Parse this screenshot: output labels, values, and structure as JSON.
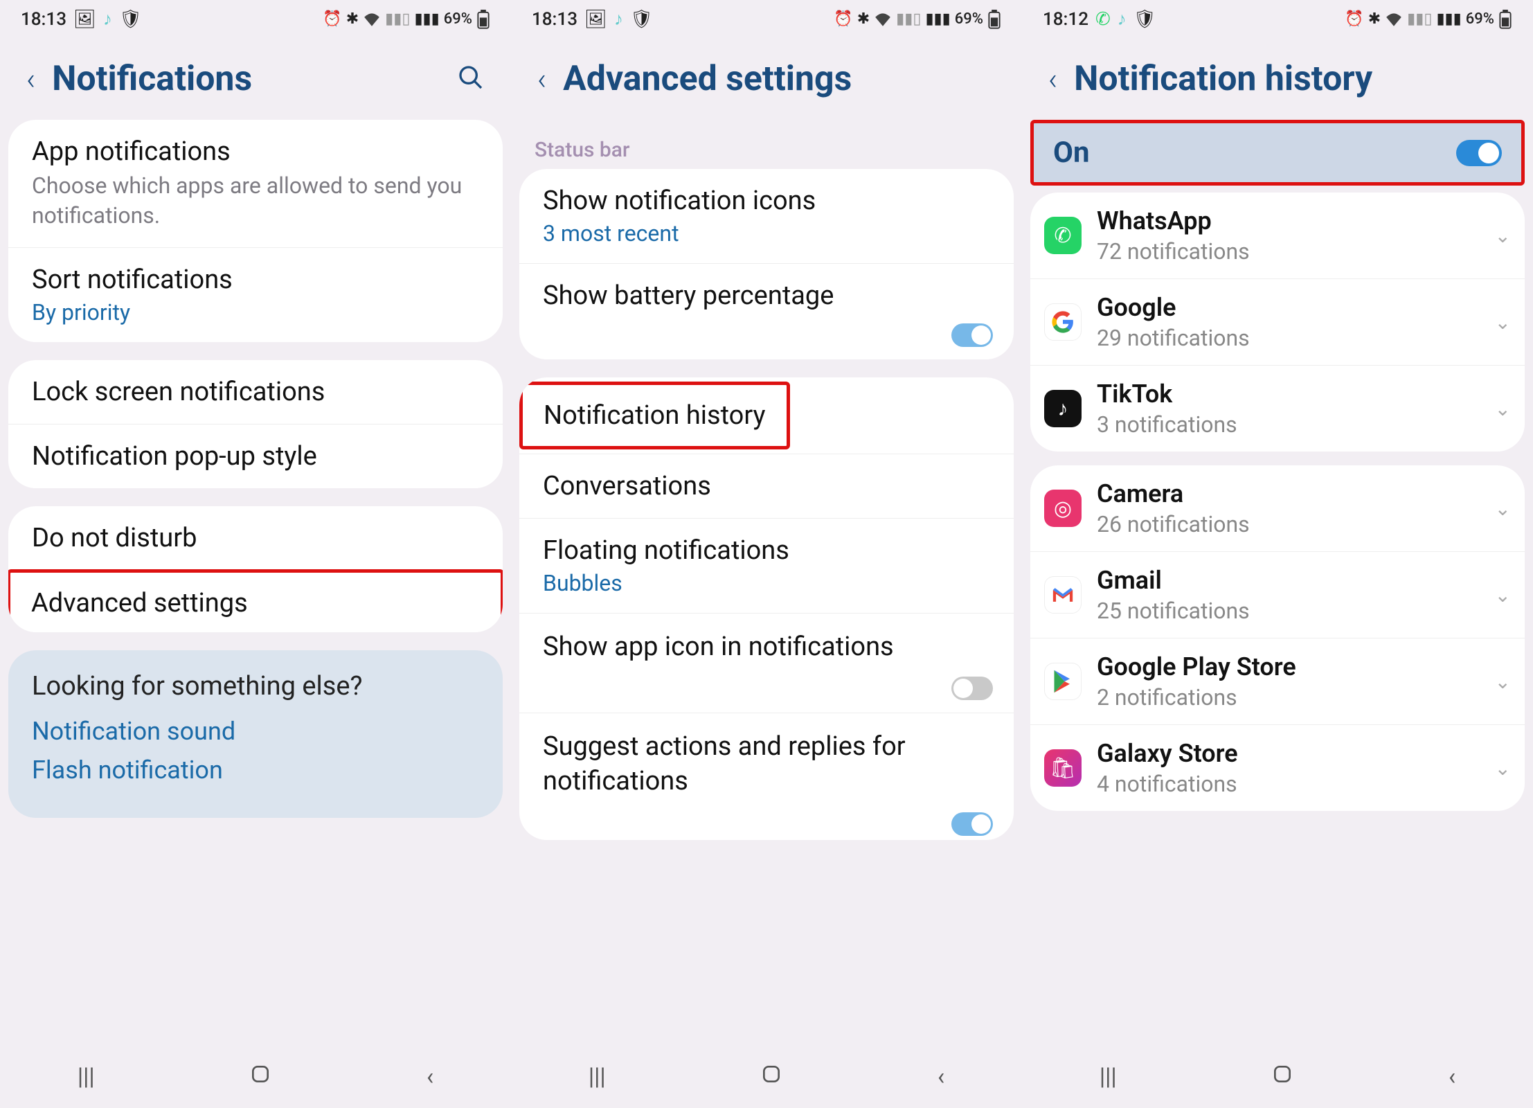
{
  "phone1": {
    "status": {
      "time": "18:13",
      "battery": "69%"
    },
    "title": "Notifications",
    "appNotif": {
      "title": "App notifications",
      "desc": "Choose which apps are allowed to send you notifications."
    },
    "sort": {
      "title": "Sort notifications",
      "sub": "By priority"
    },
    "lock": "Lock screen notifications",
    "popup": "Notification pop-up style",
    "dnd": "Do not disturb",
    "advanced": "Advanced settings",
    "footer": {
      "title": "Looking for something else?",
      "link1": "Notification sound",
      "link2": "Flash notification"
    }
  },
  "phone2": {
    "status": {
      "time": "18:13",
      "battery": "69%"
    },
    "title": "Advanced settings",
    "sectionLabel": "Status bar",
    "showIcons": {
      "title": "Show notification icons",
      "sub": "3 most recent"
    },
    "showBattery": "Show battery percentage",
    "history": "Notification history",
    "conversations": "Conversations",
    "floating": {
      "title": "Floating notifications",
      "sub": "Bubbles"
    },
    "showAppIcon": "Show app icon in notifications",
    "suggest": "Suggest actions and replies for notifications"
  },
  "phone3": {
    "status": {
      "time": "18:12",
      "battery": "69%"
    },
    "title": "Notification history",
    "onLabel": "On",
    "apps": [
      {
        "name": "WhatsApp",
        "count": "72 notifications",
        "icon": "whatsapp",
        "bg": "#25d366"
      },
      {
        "name": "Google",
        "count": "29 notifications",
        "icon": "google",
        "bg": "#fff"
      },
      {
        "name": "TikTok",
        "count": "3 notifications",
        "icon": "tiktok",
        "bg": "#111"
      },
      {
        "name": "Camera",
        "count": "26 notifications",
        "icon": "camera",
        "bg": "#e8356e"
      },
      {
        "name": "Gmail",
        "count": "25 notifications",
        "icon": "gmail",
        "bg": "#fff"
      },
      {
        "name": "Google Play Store",
        "count": "2 notifications",
        "icon": "play",
        "bg": "#fff"
      },
      {
        "name": "Galaxy Store",
        "count": "4 notifications",
        "icon": "galaxy",
        "bg": "#e8356e"
      }
    ]
  }
}
